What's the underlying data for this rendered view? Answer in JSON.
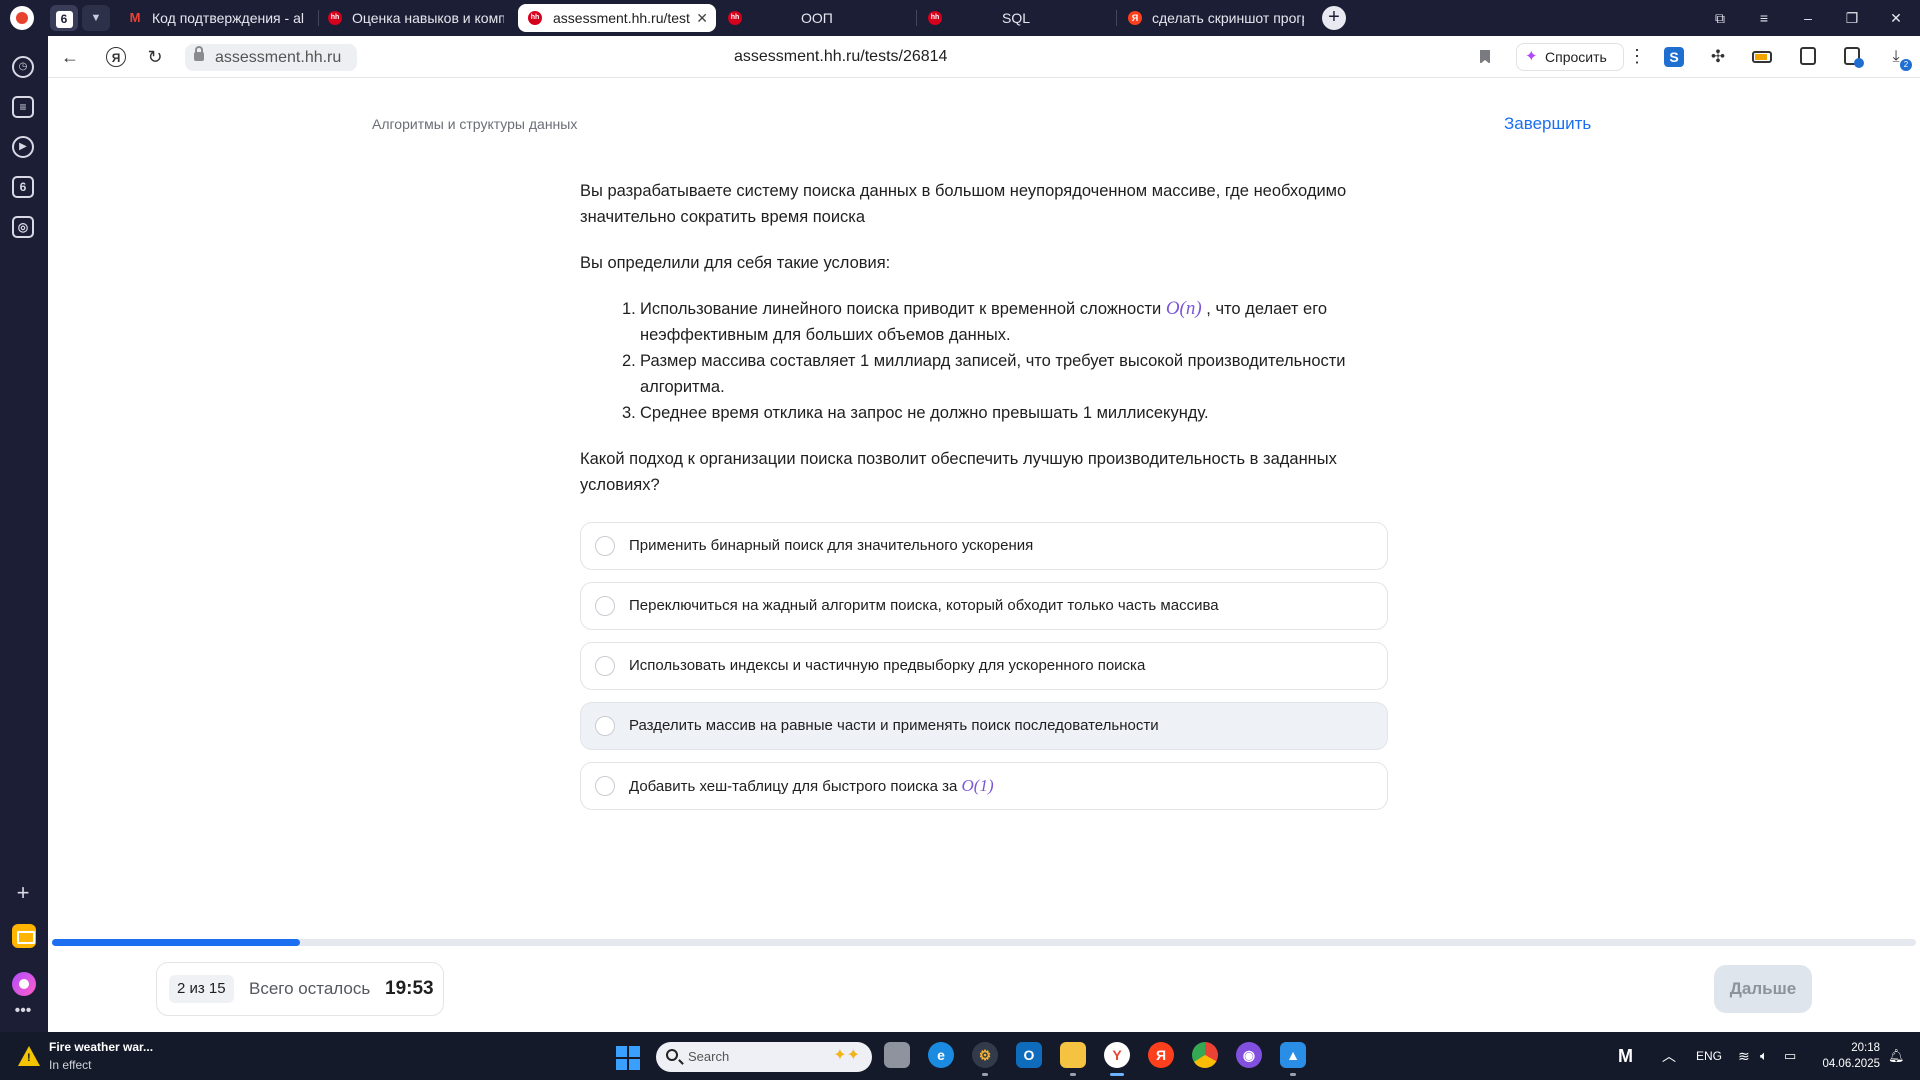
{
  "tabstrip": {
    "tab_count": "6",
    "tabs": [
      {
        "title": "Код подтверждения - ale",
        "icon": "gmail-icon"
      },
      {
        "title": "Оценка навыков и компе",
        "icon": "hh-icon"
      },
      {
        "title": "assessment.hh.ru/tests",
        "icon": "hh-icon",
        "active": true
      },
      {
        "title": "",
        "icon": "hh-icon"
      },
      {
        "title": "ООП",
        "icon": "none"
      },
      {
        "title": "SQL",
        "icon": "hh-icon"
      },
      {
        "title": "сделать скриншот прогр",
        "icon": "yandex-icon"
      }
    ]
  },
  "sidebar": {
    "icons": [
      "history-icon",
      "collections-icon",
      "video-icon",
      "counter-icon",
      "screenshot-icon",
      "add-icon",
      "mail-icon",
      "alice-icon",
      "more-icon"
    ],
    "counter_label": "6"
  },
  "addressbar": {
    "host": "assessment.hh.ru",
    "url": "assessment.hh.ru/tests/26814",
    "ask_label": "Спросить"
  },
  "page": {
    "breadcrumb": "Алгоритмы и структуры данных",
    "finish_label": "Завершить",
    "intro": "Вы разрабатываете систему поиска данных в большом неупорядоченном массиве, где необходимо значительно сократить время поиска",
    "conditions_intro": "Вы определили для себя такие условия:",
    "conditions": [
      {
        "num": "1.",
        "before": "Использование линейного поиска приводит к временной сложности ",
        "math": "O(n)",
        "after": " , что делает его неэффективным для больших объемов данных."
      },
      {
        "num": "2.",
        "before": "Размер массива составляет 1 миллиард записей, что требует высокой производительности алгоритма.",
        "math": "",
        "after": ""
      },
      {
        "num": "3.",
        "before": "Среднее время отклика на запрос не должно превышать 1 миллисекунду.",
        "math": "",
        "after": ""
      }
    ],
    "question": "Какой подход к организации поиска позволит обеспечить лучшую производительность в заданных условиях?",
    "options": [
      {
        "text": "Применить бинарный поиск для значительного ускорения",
        "math": ""
      },
      {
        "text": "Переключиться на жадный алгоритм поиска, который обходит только часть массива",
        "math": ""
      },
      {
        "text": "Использовать индексы и частичную предвыборку для ускоренного поиска",
        "math": ""
      },
      {
        "text": "Разделить массив на равные части и применять поиск последовательности",
        "math": "",
        "hover": true
      },
      {
        "text": "Добавить хеш-таблицу для быстрого поиска за ",
        "math": "O(1)"
      }
    ],
    "progress_fraction": 0.133,
    "counter": "2 из 15",
    "remaining_label": "Всего осталось",
    "timer": "19:53",
    "next_label": "Дальше",
    "colors": {
      "accent": "#1b6ff0",
      "math": "#7b56d6"
    }
  },
  "taskbar": {
    "weather_title": "Fire weather war...",
    "weather_sub": "In effect",
    "search_placeholder": "Search",
    "lang": "ENG",
    "time": "20:18",
    "date": "04.06.2025"
  }
}
